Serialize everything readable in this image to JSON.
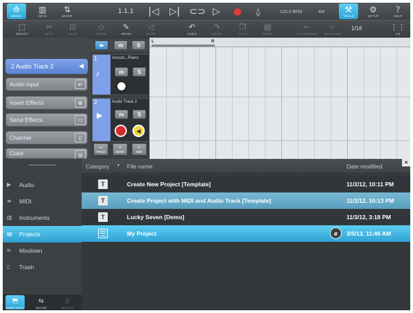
{
  "toolbar_top": {
    "media": "MEDIA",
    "keys": "KEYS",
    "mixer": "MIXER",
    "position": "1.1.1",
    "tempo": "120.0 BPM",
    "signature": "4/4",
    "tools": "TOOLS",
    "setup": "SETUP",
    "help": "HELP"
  },
  "toolbar_second": {
    "select": "SELECT",
    "split": "SPLIT",
    "glue": "GLUE",
    "erase": "ERASE",
    "draw": "DRAW",
    "mute": "MUTE",
    "undo": "UNDO",
    "redo": "REDO",
    "copy": "COPY",
    "paste": "PASTE",
    "transpose": "TRANSPOSE",
    "quantize": "QUANTIZE",
    "quantize_value": "1/16",
    "quantize_grid": "1/8"
  },
  "inspector": {
    "track_name": "2 Audio Track 2",
    "audio_input": "Audio input",
    "insert_effects": "Insert Effects",
    "send_effects": "Send Effects",
    "channel": "Channel",
    "color": "Color"
  },
  "tracks": [
    {
      "number": "1",
      "name": "Acoust...Piano"
    },
    {
      "number": "2",
      "name": "Audio Track 2"
    }
  ],
  "track_buttons": {
    "track": "TRACK",
    "audio": "AUDIO",
    "midi": "MIDI"
  },
  "ruler": {
    "left_locator": "L",
    "right_locator": "R"
  },
  "categories": [
    "Audio",
    "MIDI",
    "Instruments",
    "Projects",
    "Mixdown",
    "Trash"
  ],
  "category_icons": [
    "play-icon",
    "midi-icon",
    "instruments-icon",
    "projects-icon",
    "mixdown-icon",
    "trash-icon"
  ],
  "browser_header": {
    "category": "Category",
    "file_name": "File name",
    "date_modified": "Date modified"
  },
  "files": [
    {
      "type_icon": "T",
      "name": "Create New Project [Template]",
      "date": "11/2/12, 10:11 PM"
    },
    {
      "type_icon": "T",
      "name": "Create Project with MIDI and Audio Track [Template]",
      "date": "11/2/12, 10:13 PM"
    },
    {
      "type_icon": "T",
      "name": "Lucky Seven [Demo]",
      "date": "11/3/12, 3:18 PM"
    },
    {
      "type_icon": "project",
      "name": "My Project",
      "date": "3/5/13, 11:46 AM"
    }
  ],
  "bottom_bar": {
    "snapshot": "SNAP SHOT",
    "share": "SHARE",
    "delete": "DELETE"
  },
  "colors": {
    "accent": "#2fa2d6",
    "track_blue": "#7ea0ea",
    "record_red": "#d62b2b",
    "mute_yellow": "#f4d23a"
  }
}
